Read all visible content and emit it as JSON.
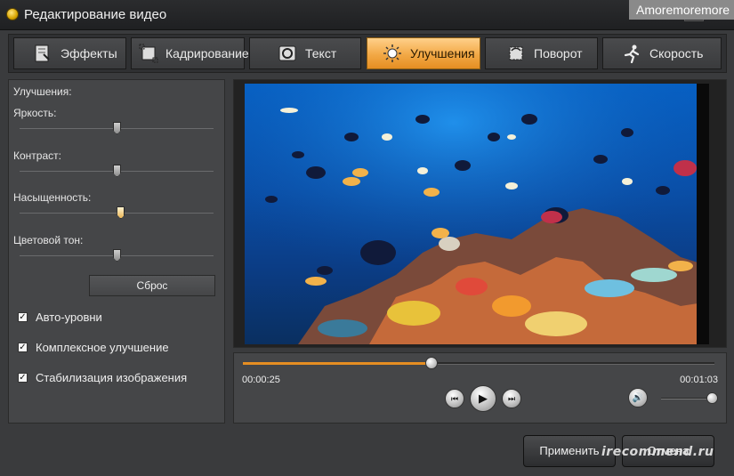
{
  "window": {
    "title": "Редактирование видео",
    "close_glyph": "×"
  },
  "watermarks": {
    "top": "Amoremoremore",
    "bottom": "irecommend.ru"
  },
  "tabs": [
    {
      "label": "Эффекты",
      "icon": "effects-icon"
    },
    {
      "label": "Кадрирование",
      "icon": "crop-icon"
    },
    {
      "label": "Текст",
      "icon": "text-icon"
    },
    {
      "label": "Улучшения",
      "icon": "sun-icon",
      "active": true
    },
    {
      "label": "Поворот",
      "icon": "rotate-icon"
    },
    {
      "label": "Скорость",
      "icon": "runner-icon"
    }
  ],
  "enhance": {
    "heading": "Улучшения:",
    "sliders": [
      {
        "label": "Яркость:",
        "value": 0.5
      },
      {
        "label": "Контраст:",
        "value": 0.5
      },
      {
        "label": "Насыщенность:",
        "value": 0.52
      },
      {
        "label": "Цветовой тон:",
        "value": 0.5
      }
    ],
    "reset_label": "Сброс",
    "checks": [
      {
        "label": "Авто-уровни",
        "checked": true
      },
      {
        "label": "Комплексное улучшение",
        "checked": true
      },
      {
        "label": "Стабилизация изображения",
        "checked": true
      }
    ]
  },
  "player": {
    "current_time": "00:00:25",
    "total_time": "00:01:03",
    "progress": 0.4,
    "volume": 1.0,
    "prev_glyph": "⏮",
    "play_glyph": "▶",
    "next_glyph": "⏭",
    "volume_glyph": "🔊"
  },
  "buttons": {
    "apply": "Применить",
    "cancel": "Отмена"
  },
  "colors": {
    "accent": "#f2a845",
    "background": "#3a3b3d"
  }
}
